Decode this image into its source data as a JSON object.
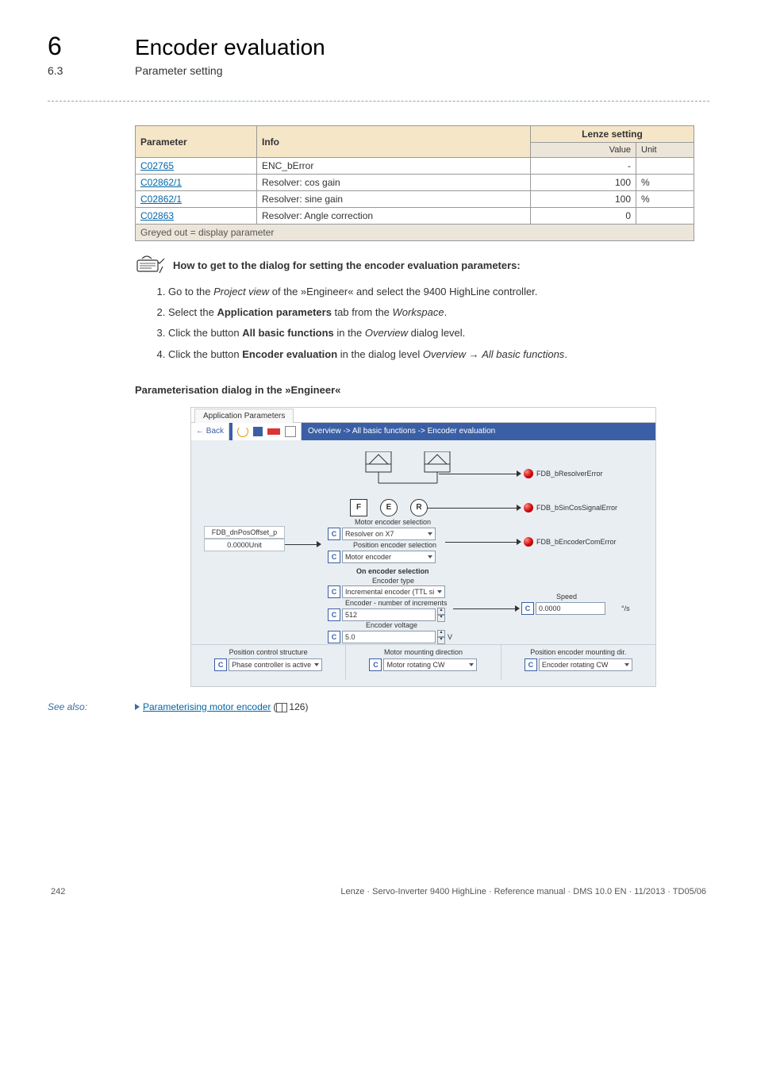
{
  "chapter": {
    "num": "6",
    "title": "Encoder evaluation"
  },
  "section": {
    "num": "6.3",
    "title": "Parameter setting"
  },
  "table": {
    "headers": {
      "param": "Parameter",
      "info": "Info",
      "lenze": "Lenze setting",
      "value": "Value",
      "unit": "Unit"
    },
    "rows": [
      {
        "param": "C02765",
        "info": "ENC_bError",
        "value": "-",
        "unit": ""
      },
      {
        "param": "C02862/1",
        "info": "Resolver: cos gain",
        "value": "100",
        "unit": "%"
      },
      {
        "param": "C02862/1",
        "info": "Resolver: sine gain",
        "value": "100",
        "unit": "%"
      },
      {
        "param": "C02863",
        "info": "Resolver: Angle correction",
        "value": "0",
        "unit": ""
      }
    ],
    "footer": "Greyed out = display parameter"
  },
  "howto": {
    "title": "How to get to the dialog for setting the encoder evaluation parameters:",
    "step1a": "Go to the ",
    "step1b": "Project view",
    "step1c": " of the »Engineer« and select the 9400 HighLine controller.",
    "step2a": "Select the ",
    "step2b": "Application parameters",
    "step2c": " tab from the ",
    "step2d": "Workspace",
    "step2e": ".",
    "step3a": "Click the button ",
    "step3b": "All basic functions",
    "step3c": " in the ",
    "step3d": "Overview",
    "step3e": " dialog level.",
    "step4a": "Click the button ",
    "step4b": "Encoder evaluation",
    "step4c": " in the dialog level ",
    "step4d": "Overview",
    "step4e": " → ",
    "step4f": "All basic functions",
    "step4g": "."
  },
  "dialog_heading": "Parameterisation dialog in the »Engineer«",
  "screenshot": {
    "tab": "Application Parameters",
    "back": "← Back",
    "breadcrumb": "Overview -> All basic functions -> Encoder evaluation",
    "left_in1": "FDB_dnPosOffset_p",
    "left_in2": "0.0000Unit",
    "node_f": "F",
    "node_e": "E",
    "node_r": "R",
    "node_caption": "Motor encoder selection",
    "dd1_label": "Resolver on X7",
    "dd2_caption": "Position encoder selection",
    "dd2_label": "Motor encoder",
    "enc_sel_hdr": "On encoder selection",
    "enc_type_lbl": "Encoder type",
    "enc_type_val": "Incremental encoder (TTL si",
    "enc_incr_lbl": "Encoder - number of increments",
    "enc_incr_val": "512",
    "enc_volt_lbl": "Encoder voltage",
    "enc_volt_val": "5.0",
    "enc_volt_unit": "V",
    "out1": "FDB_bResolverError",
    "out2": "FDB_bSinCosSignalError",
    "out3": "FDB_bEncoderComError",
    "speed_lbl": "Speed",
    "speed_val": "0.0000",
    "speed_unit": "°/s",
    "b1_lbl": "Position control structure",
    "b1_val": "Phase controller is active",
    "b2_lbl": "Motor mounting direction",
    "b2_val": "Motor rotating CW",
    "b3_lbl": "Position encoder mounting dir.",
    "b3_val": "Encoder rotating CW"
  },
  "see_also": {
    "label": "See also:",
    "link": "Parameterising motor encoder",
    "page": "126"
  },
  "footer": {
    "pagenum": "242",
    "text": "Lenze · Servo-Inverter 9400 HighLine · Reference manual · DMS 10.0 EN · 11/2013 · TD05/06"
  }
}
